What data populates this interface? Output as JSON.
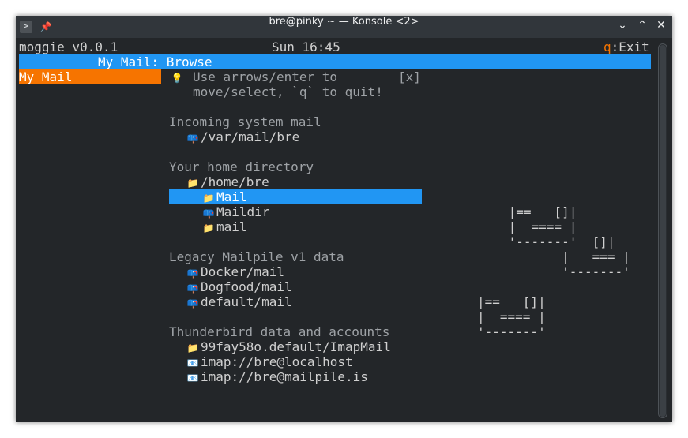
{
  "window": {
    "title": "bre@pinky ~ — Konsole <2>"
  },
  "statusline": {
    "app": "moggie v0.0.1",
    "clock": "Sun 16:45",
    "quit_key": "q",
    "quit_label": ":Exit"
  },
  "header": {
    "title": "My Mail: Browse"
  },
  "sidebar": {
    "items": [
      {
        "label": "My Mail"
      }
    ]
  },
  "tip": {
    "line1": "Use arrows/enter to",
    "line2": "move/select, `q` to quit!",
    "close": "[x]"
  },
  "sections": [
    {
      "title": "Incoming system mail",
      "items": [
        {
          "icon": "mailbox-icon",
          "label": "/var/mail/bre"
        }
      ]
    },
    {
      "title": "Your home directory",
      "items": [
        {
          "icon": "folder-icon",
          "label": "/home/bre",
          "indent": 0
        },
        {
          "icon": "folder-icon",
          "label": "Mail",
          "indent": 1,
          "selected": true
        },
        {
          "icon": "mailbox-icon",
          "label": "Maildir",
          "indent": 1
        },
        {
          "icon": "folder-icon",
          "label": "mail",
          "indent": 1
        }
      ]
    },
    {
      "title": "Legacy Mailpile v1 data",
      "items": [
        {
          "icon": "mailbox-icon",
          "label": "Docker/mail"
        },
        {
          "icon": "mailbox-icon",
          "label": "Dogfood/mail"
        },
        {
          "icon": "mailbox-icon",
          "label": "default/mail"
        }
      ]
    },
    {
      "title": "Thunderbird data and accounts",
      "items": [
        {
          "icon": "folder-icon",
          "label": "99fay58o.default/ImapMail"
        },
        {
          "icon": "envelope-icon",
          "label": "imap://bre@localhost"
        },
        {
          "icon": "envelope-icon",
          "label": "imap://bre@mailpile.is"
        }
      ]
    }
  ],
  "ascii_art": [
    "  _______",
    " |==   []|",
    " |  ==== |____",
    " '-------'  []|",
    "        |   === |",
    "        '-------'",
    "",
    "_______",
    "|==   []|",
    "|  ==== |",
    "'-------'"
  ],
  "colors": {
    "selected": "#2196f3",
    "accent": "#f67400",
    "background": "#232629"
  }
}
